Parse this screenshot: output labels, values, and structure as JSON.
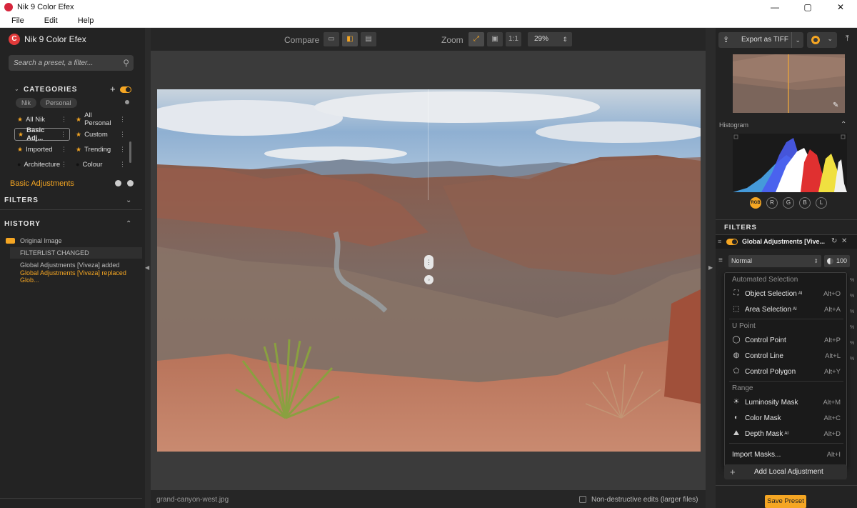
{
  "window": {
    "title": "Nik 9 Color Efex",
    "controls": [
      "—",
      "▢",
      "✕"
    ]
  },
  "menubar": {
    "items": [
      "File",
      "Edit",
      "Help"
    ]
  },
  "left": {
    "brand": "Nik 9 Color Efex",
    "search_placeholder": "Search a preset, a filter...",
    "categories_title": "CATEGORIES",
    "pills": [
      "Nik",
      "Personal"
    ],
    "categories": [
      {
        "label": "All Nik",
        "starred": true
      },
      {
        "label": "All Personal",
        "starred": true
      },
      {
        "label": "Basic Adj...",
        "starred": true,
        "selected": true
      },
      {
        "label": "Custom",
        "starred": true
      },
      {
        "label": "Imported",
        "starred": true
      },
      {
        "label": "Trending",
        "starred": true
      },
      {
        "label": "Architecture",
        "starred": false
      },
      {
        "label": "Colour",
        "starred": false
      }
    ],
    "active_category": "Basic Adjustments",
    "filters_title": "FILTERS",
    "history_title": "HISTORY",
    "history": [
      {
        "label": "Original Image"
      },
      {
        "label": "FILTERLIST CHANGED"
      },
      {
        "label": "Global Adjustments [Viveza] added"
      },
      {
        "label": "Global Adjustments [Viveza] replaced Glob..."
      }
    ]
  },
  "center": {
    "compare_label": "Compare",
    "zoom_label": "Zoom",
    "zoom_one_to_one": "1:1",
    "zoom_value": "29%",
    "filename": "grand-canyon-west.jpg",
    "nondestructive_label": "Non-destructive edits (larger files)"
  },
  "right": {
    "export_label": "Export as TIFF",
    "histogram_title": "Histogram",
    "channels": [
      "RGB",
      "R",
      "G",
      "B",
      "L"
    ],
    "filters_title": "FILTERS",
    "filter_name": "Global Adjustments [Vive...",
    "blend_mode": "Normal",
    "opacity": "100",
    "menu": {
      "groups": [
        {
          "title": "Automated Selection",
          "items": [
            {
              "label": "Object Selection",
              "ai": "AI",
              "shortcut": "Alt+O",
              "icon": "object-selection-icon"
            },
            {
              "label": "Area Selection",
              "ai": "AI",
              "shortcut": "Alt+A",
              "icon": "area-selection-icon"
            }
          ]
        },
        {
          "title": "U Point",
          "items": [
            {
              "label": "Control Point",
              "shortcut": "Alt+P",
              "icon": "control-point-icon"
            },
            {
              "label": "Control Line",
              "shortcut": "Alt+L",
              "icon": "control-line-icon"
            },
            {
              "label": "Control Polygon",
              "shortcut": "Alt+Y",
              "icon": "control-polygon-icon"
            }
          ]
        },
        {
          "title": "Range",
          "items": [
            {
              "label": "Luminosity Mask",
              "shortcut": "Alt+M",
              "icon": "luminosity-mask-icon"
            },
            {
              "label": "Color Mask",
              "shortcut": "Alt+C",
              "icon": "color-mask-icon"
            },
            {
              "label": "Depth Mask",
              "ai": "AI",
              "shortcut": "Alt+D",
              "icon": "depth-mask-icon"
            }
          ]
        }
      ],
      "import_masks": "Import Masks...",
      "import_shortcut": "Alt+I"
    },
    "add_local": "Add Local Adjustment",
    "save_preset": "Save Preset"
  },
  "colors": {
    "accent": "#f5a623",
    "panel": "#232323",
    "canvas": "#3b3b3b"
  }
}
